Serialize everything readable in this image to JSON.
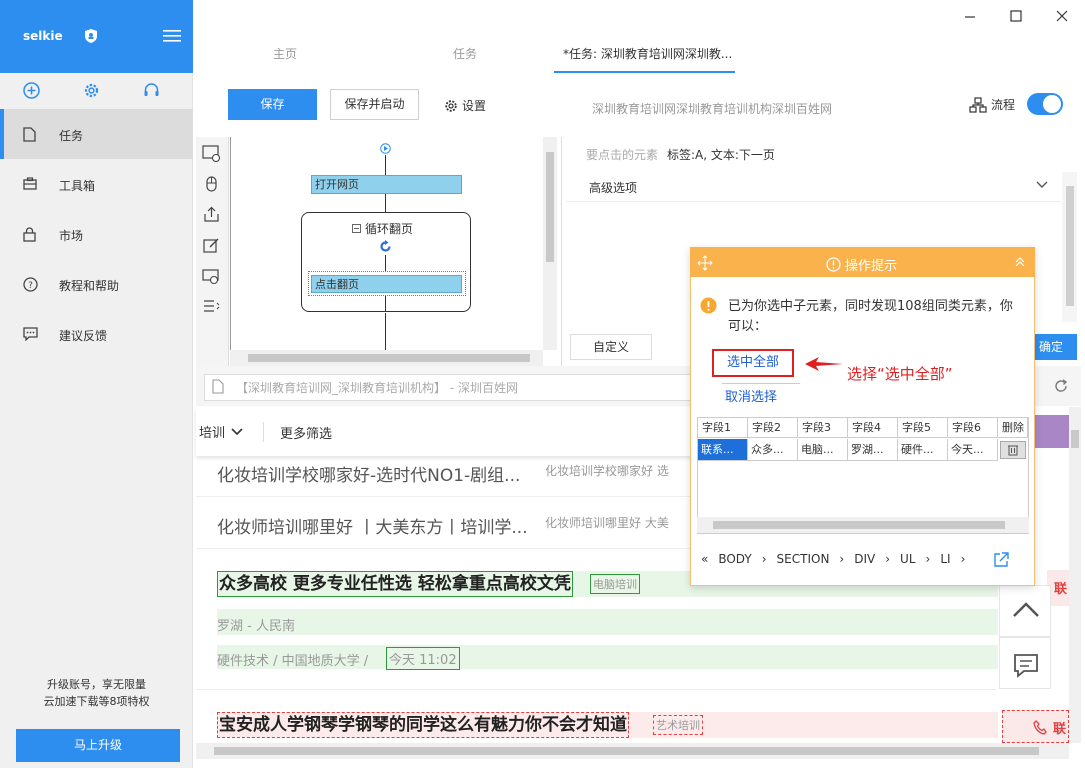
{
  "sidebar": {
    "user": "selkie",
    "items": [
      {
        "label": "任务",
        "icon": "document-icon",
        "active": true
      },
      {
        "label": "工具箱",
        "icon": "toolbox-icon",
        "active": false
      },
      {
        "label": "市场",
        "icon": "lock-icon",
        "active": false
      },
      {
        "label": "教程和帮助",
        "icon": "help-icon",
        "active": false
      },
      {
        "label": "建议反馈",
        "icon": "feedback-icon",
        "active": false
      }
    ],
    "upgrade_line1": "升级账号，享无限量",
    "upgrade_line2": "云加速下载等8项特权",
    "upgrade_button": "马上升级"
  },
  "tabs": [
    "主页",
    "任务",
    "*任务: 深圳教育培训网深圳教..."
  ],
  "toolbar": {
    "save": "保存",
    "save_start": "保存并启动",
    "settings": "设置",
    "task_title": "深圳教育培训网深圳教育培训机构深圳百姓网",
    "flow": "流程",
    "flow_on": true
  },
  "workflow": {
    "open_page": "打开网页",
    "loop": "循环翻页",
    "click_next": "点击翻页"
  },
  "config": {
    "element_label": "要点击的元素",
    "element_value": "标签:A, 文本:下一页",
    "advanced": "高级选项",
    "custom": "自定义",
    "confirm": "确定"
  },
  "browser": {
    "address": "【深圳教育培训网_深圳教育培训机构】 - 深圳百姓网",
    "filter1": "培训",
    "filter2": "更多筛选",
    "results": [
      {
        "title": "化妆培训学校哪家好-选时代NO1-剧组...",
        "sub": "化妆培训学校哪家好 选"
      },
      {
        "title": "化妆师培训哪里好 丨大美东方丨培训学...",
        "sub": "化妆师培训哪里好 大美"
      },
      {
        "title": "众多高校 更多专业任性选 轻松拿重点高校文凭",
        "tag": "电脑培训",
        "loc": "罗湖 - 人民南",
        "meta": "硬件技术 / 中国地质大学 /",
        "time": "今天 11:02"
      },
      {
        "title": "宝安成人学钢琴学钢琴的同学这么有魅力你不会才知道",
        "tag": "艺术培训"
      }
    ],
    "side_call": "联"
  },
  "popup": {
    "title": "操作提示",
    "message": "已为你选中子元素，同时发现108组同类元素，你可以：",
    "select_all": "选中全部",
    "cancel": "取消选择",
    "annotation": "选择“选中全部”",
    "columns": [
      "字段1",
      "字段2",
      "字段3",
      "字段4",
      "字段5",
      "字段6",
      "删除"
    ],
    "row": [
      "联系...",
      "众多...",
      "电脑...",
      "罗湖...",
      "硬件...",
      "今天..."
    ],
    "crumbs": [
      "«",
      "BODY",
      "›",
      "SECTION",
      "›",
      "DIV",
      "›",
      "UL",
      "›",
      "LI",
      "›"
    ]
  },
  "colors": {
    "accent": "#2d8ef0",
    "popup_header": "#f9b24c",
    "highlight_red": "#e02020",
    "highlight_green": "#2a9a3a"
  }
}
